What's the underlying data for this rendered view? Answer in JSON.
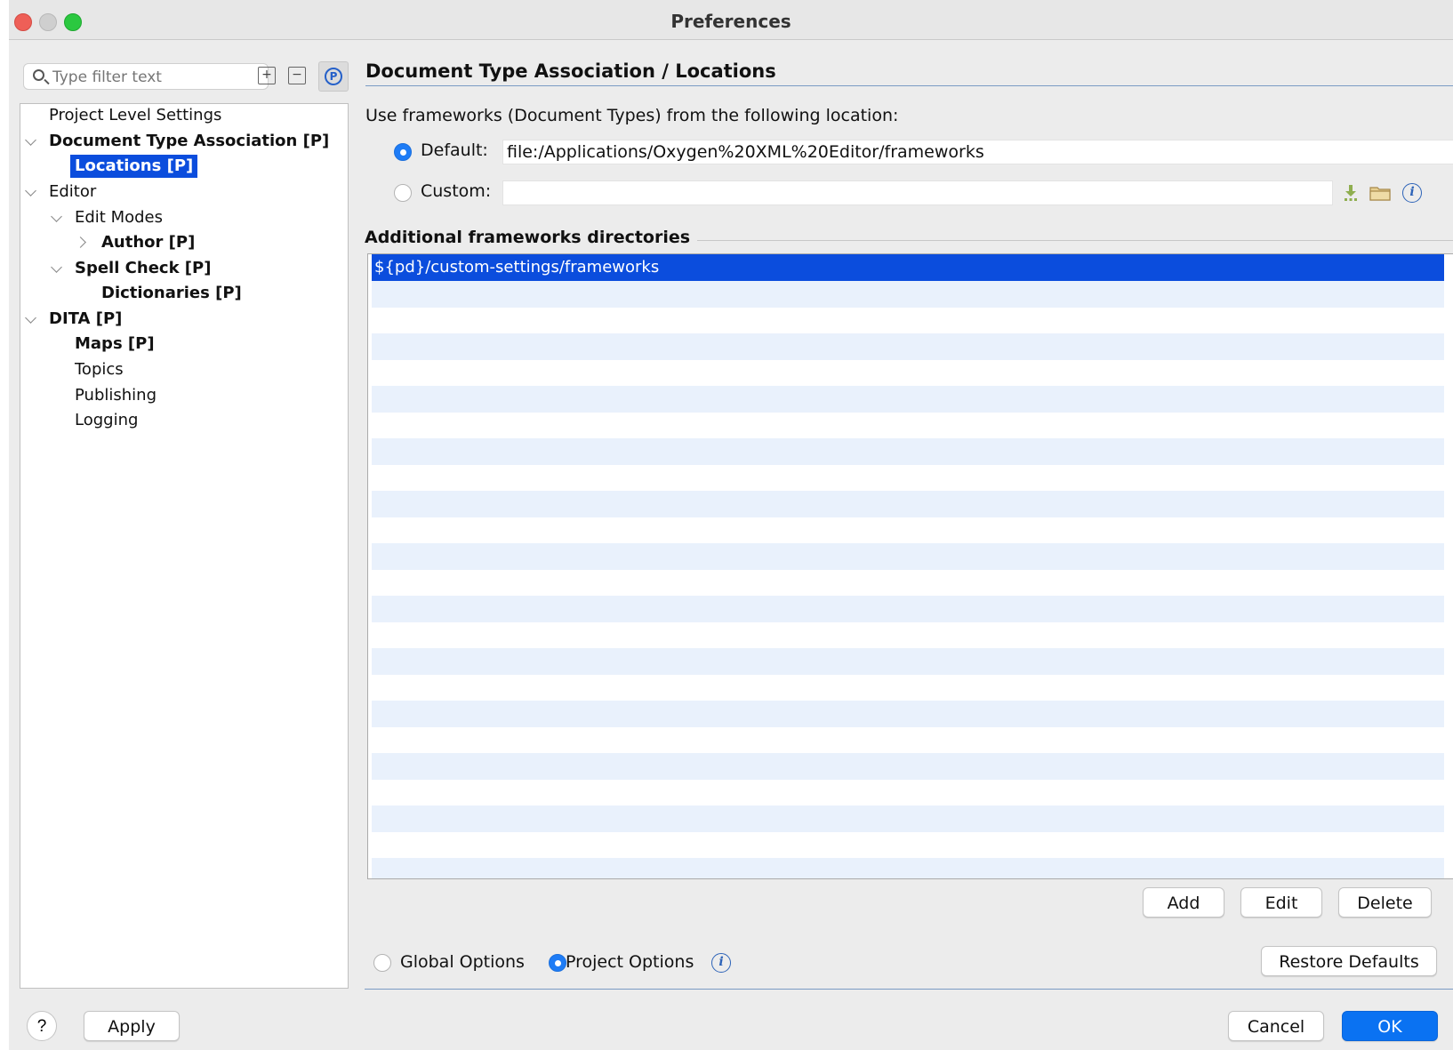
{
  "window": {
    "title": "Preferences"
  },
  "sidebar": {
    "filter_placeholder": "Type filter text",
    "expand_all_glyph": "+",
    "collapse_all_glyph": "−",
    "project_badge": "P",
    "tree": [
      {
        "label": "Project Level Settings"
      },
      {
        "label": "Document Type Association [P]"
      },
      {
        "label": "Locations [P]"
      },
      {
        "label": "Editor"
      },
      {
        "label": "Edit Modes"
      },
      {
        "label": "Author [P]"
      },
      {
        "label": "Spell Check [P]"
      },
      {
        "label": "Dictionaries [P]"
      },
      {
        "label": "DITA [P]"
      },
      {
        "label": "Maps [P]"
      },
      {
        "label": "Topics"
      },
      {
        "label": "Publishing"
      },
      {
        "label": "Logging"
      }
    ]
  },
  "main": {
    "title": "Document Type Association  /  Locations",
    "use_frameworks_label": "Use frameworks (Document Types) from the following location:",
    "default_label": "Default:",
    "default_value": "file:/Applications/Oxygen%20XML%20Editor/frameworks",
    "custom_label": "Custom:",
    "custom_value": "",
    "additional_title": "Additional frameworks directories",
    "directories": [
      "${pd}/custom-settings/frameworks"
    ],
    "buttons": {
      "add": "Add",
      "edit": "Edit",
      "delete": "Delete"
    },
    "global_options_label": "Global Options",
    "project_options_label": "Project Options",
    "restore_defaults": "Restore Defaults"
  },
  "footer": {
    "help": "?",
    "apply": "Apply",
    "cancel": "Cancel",
    "ok": "OK"
  },
  "colors": {
    "accent": "#0B4DDD",
    "primary_button": "#0A72F2",
    "row_alt": "#E9F1FC"
  }
}
